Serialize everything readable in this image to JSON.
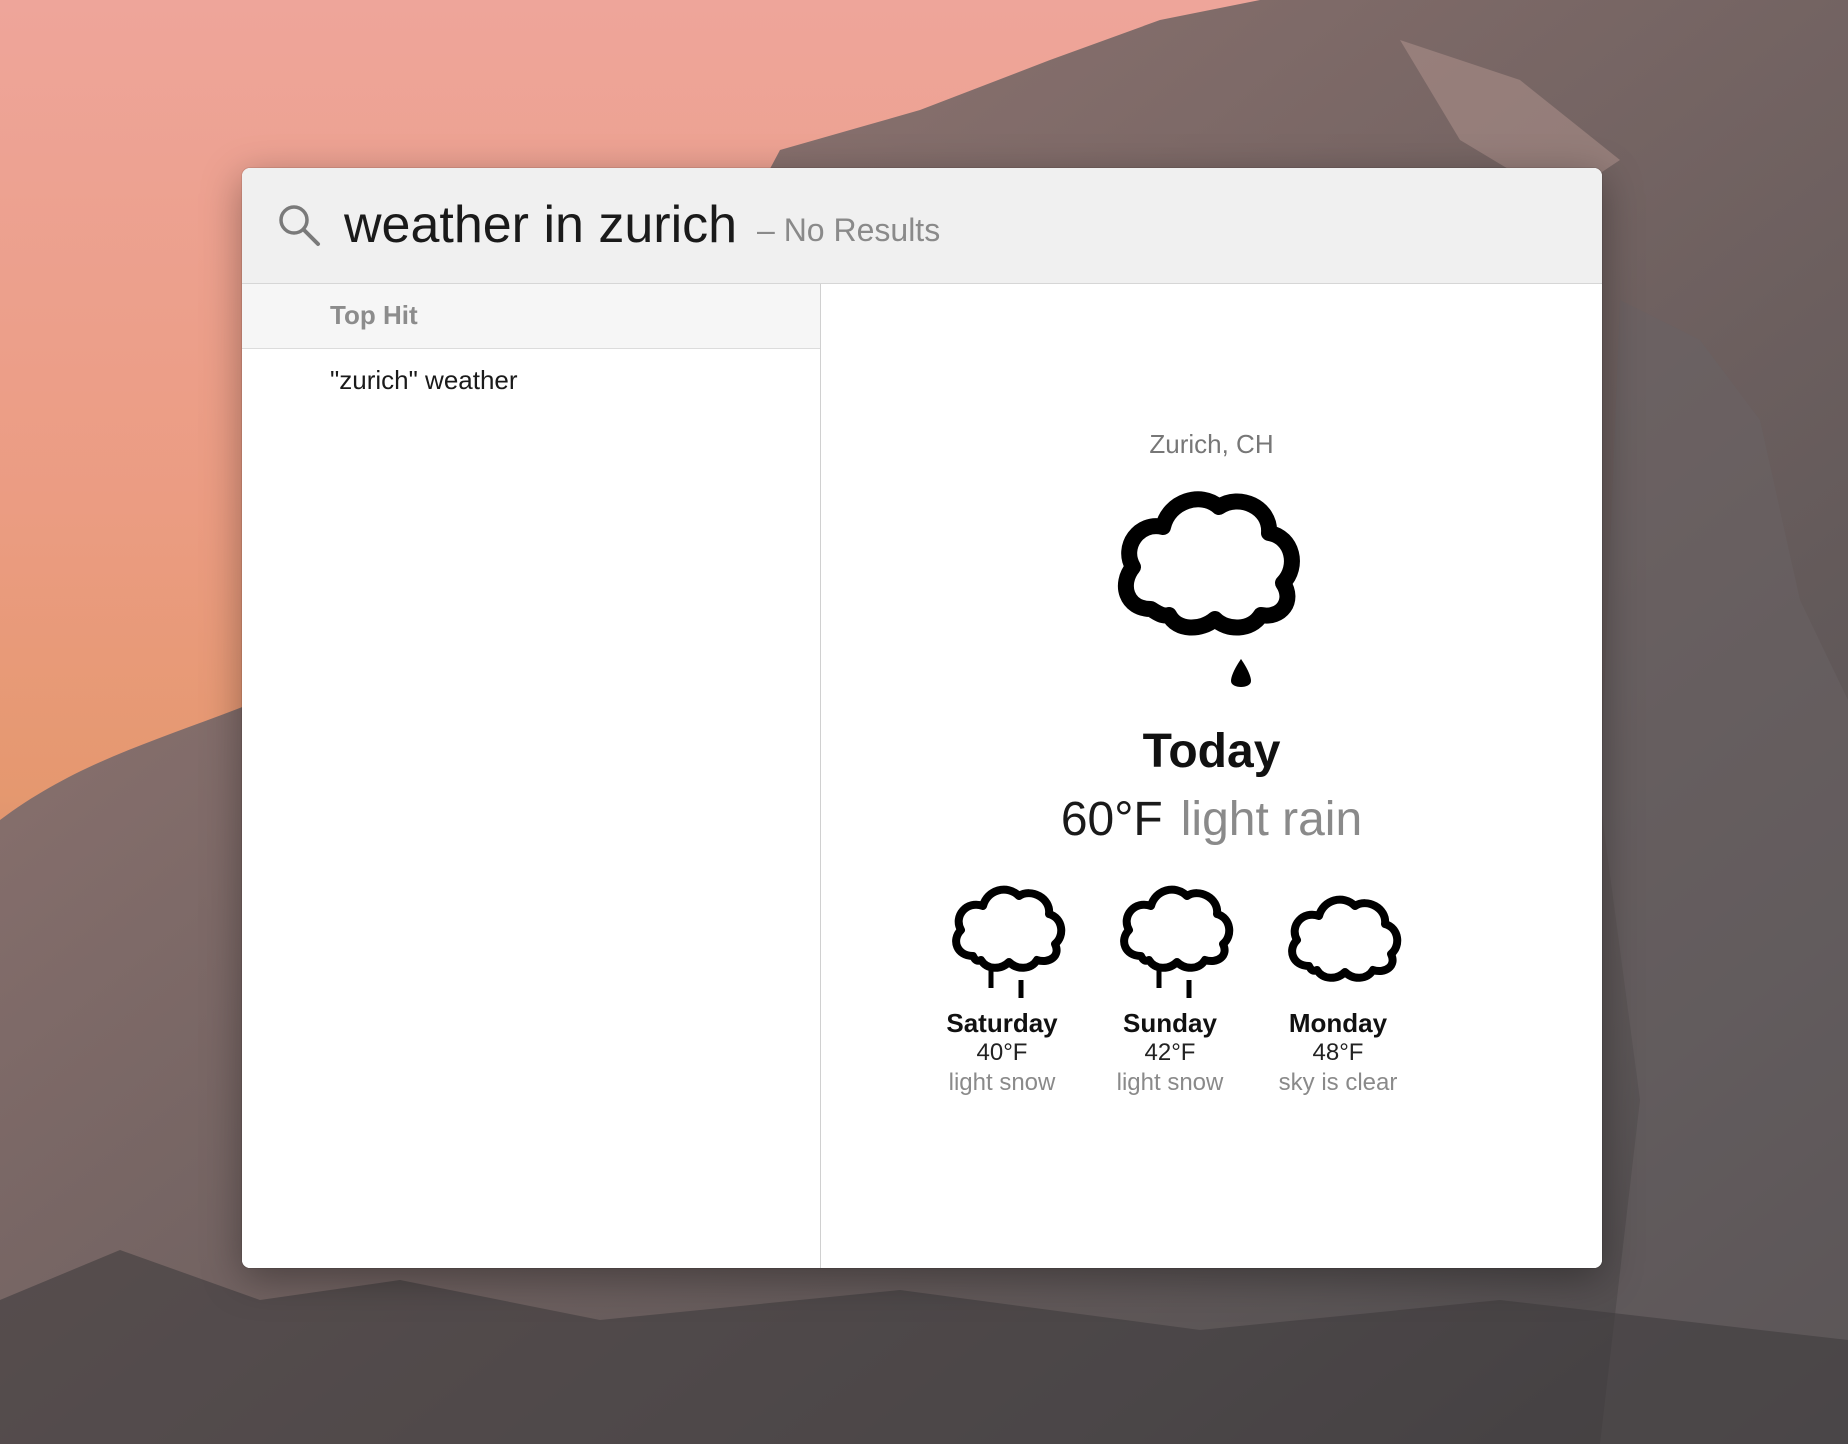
{
  "search": {
    "query": "weather in zurich",
    "status": "– No Results"
  },
  "results": {
    "section_header": "Top Hit",
    "items": [
      {
        "label": "\"zurich\" weather"
      }
    ]
  },
  "weather": {
    "location": "Zurich, CH",
    "today": {
      "label": "Today",
      "temp": "60°F",
      "condition": "light rain",
      "icon": "cloud-rain-icon"
    },
    "forecast": [
      {
        "day": "Saturday",
        "temp": "40°F",
        "condition": "light snow",
        "icon": "cloud-snow-icon"
      },
      {
        "day": "Sunday",
        "temp": "42°F",
        "condition": "light snow",
        "icon": "cloud-snow-icon"
      },
      {
        "day": "Monday",
        "temp": "48°F",
        "condition": "sky is clear",
        "icon": "cloud-icon"
      }
    ]
  }
}
